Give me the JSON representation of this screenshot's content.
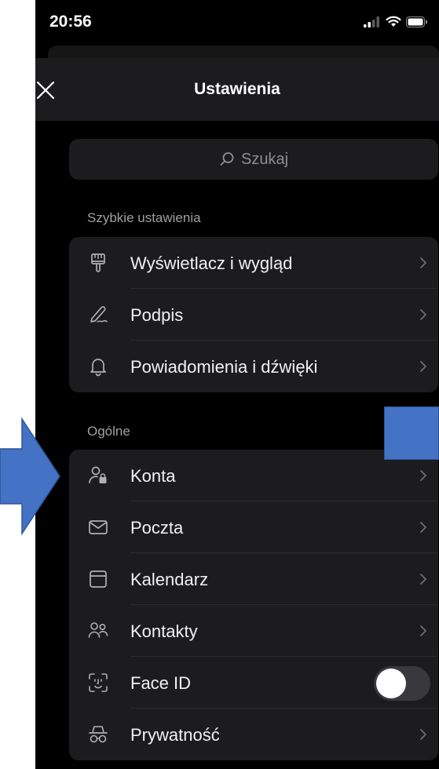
{
  "status_bar": {
    "time": "20:56"
  },
  "header": {
    "title": "Ustawienia"
  },
  "search": {
    "placeholder": "Szukaj"
  },
  "sections": [
    {
      "label": "Szybkie ustawienia",
      "items": [
        {
          "label": "Wyświetlacz i wygląd",
          "icon": "paint-brush-icon"
        },
        {
          "label": "Podpis",
          "icon": "signature-pen-icon"
        },
        {
          "label": "Powiadomienia i dźwięki",
          "icon": "bell-icon"
        }
      ]
    },
    {
      "label": "Ogólne",
      "items": [
        {
          "label": "Konta",
          "icon": "account-lock-icon"
        },
        {
          "label": "Poczta",
          "icon": "envelope-icon"
        },
        {
          "label": "Kalendarz",
          "icon": "calendar-icon"
        },
        {
          "label": "Kontakty",
          "icon": "contacts-icon"
        },
        {
          "label": "Face ID",
          "icon": "face-id-icon",
          "toggle": false
        },
        {
          "label": "Prywatność",
          "icon": "incognito-icon"
        }
      ]
    }
  ],
  "colors": {
    "background": "#000000",
    "group_background": "#1c1c1e",
    "overlay_arrow": "#4472c4"
  }
}
